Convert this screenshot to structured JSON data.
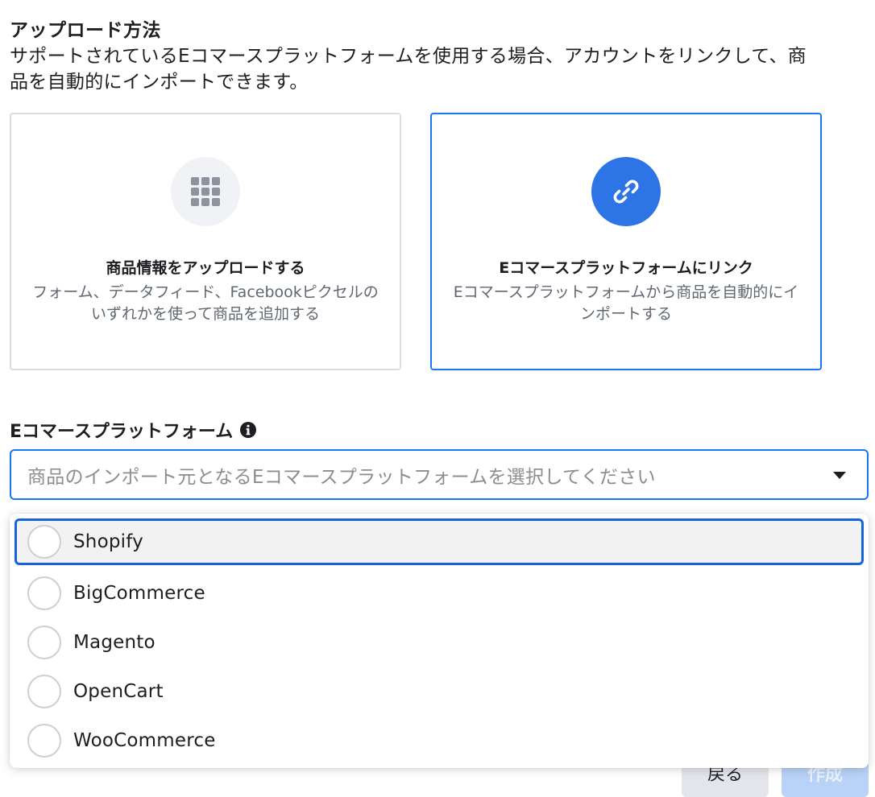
{
  "upload_method": {
    "title": "アップロード方法",
    "description": "サポートされているEコマースプラットフォームを使用する場合、アカウントをリンクして、商品を自動的にインポートできます。"
  },
  "cards": [
    {
      "title": "商品情報をアップロードする",
      "description": "フォーム、データフィード、Facebookピクセルのいずれかを使って商品を追加する",
      "icon": "grid-icon",
      "selected": false
    },
    {
      "title": "Eコマースプラットフォームにリンク",
      "description": "Eコマースプラットフォームから商品を自動的にインポートする",
      "icon": "link-icon",
      "selected": true
    }
  ],
  "platform_field": {
    "label": "Eコマースプラットフォーム",
    "info_icon": "info-icon",
    "placeholder": "商品のインポート元となるEコマースプラットフォームを選択してください"
  },
  "dropdown": {
    "options": [
      {
        "label": "Shopify",
        "highlighted": true
      },
      {
        "label": "BigCommerce",
        "highlighted": false
      },
      {
        "label": "Magento",
        "highlighted": false
      },
      {
        "label": "OpenCart",
        "highlighted": false
      },
      {
        "label": "WooCommerce",
        "highlighted": false
      }
    ]
  },
  "footer": {
    "back_label": "戻る",
    "create_label": "作成"
  },
  "colors": {
    "accent": "#1877f2",
    "link_icon_bg": "#2d74e6",
    "highlight_border": "#1565d8"
  }
}
